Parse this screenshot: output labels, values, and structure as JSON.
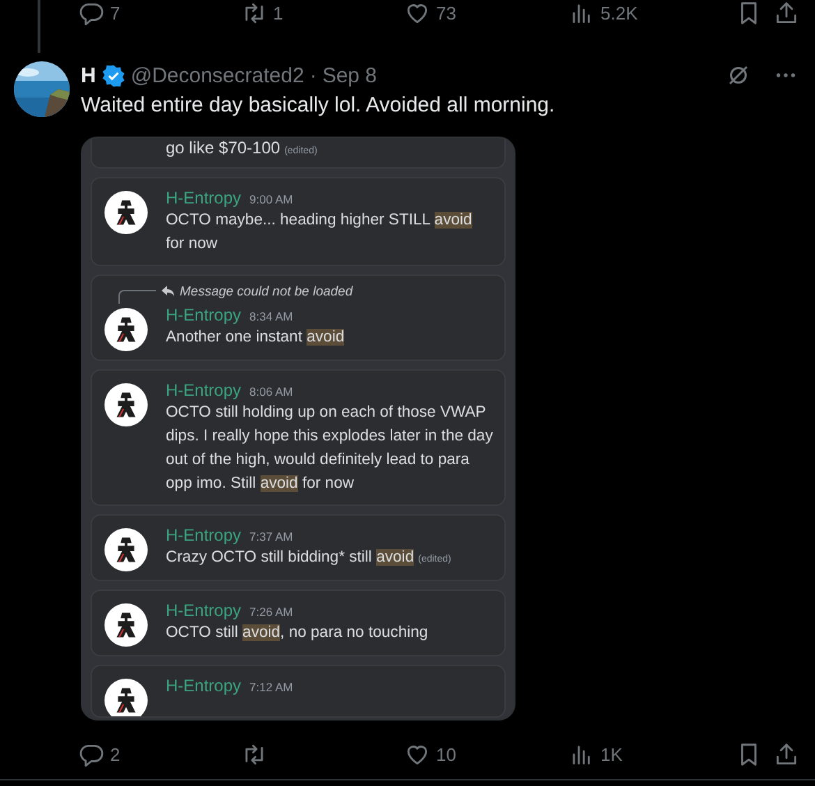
{
  "top_actions": [
    {
      "kind": "reply",
      "count": "7"
    },
    {
      "kind": "repost",
      "count": "1"
    },
    {
      "kind": "like",
      "count": "73"
    },
    {
      "kind": "views",
      "count": "5.2K"
    },
    {
      "kind": "bookmark"
    },
    {
      "kind": "share"
    }
  ],
  "tweet": {
    "name": "H",
    "verified": true,
    "handle": "@Deconsecrated2",
    "separator": "·",
    "date": "Sep 8",
    "text": "Waited entire day basically lol. Avoided all morning."
  },
  "attachment": {
    "messages": [
      {
        "kind": "partial",
        "parts": [
          {
            "text": "go like $70-100",
            "highlight": false
          }
        ],
        "edited": "(edited)"
      },
      {
        "kind": "message",
        "author": "H-Entropy",
        "time": "9:00 AM",
        "parts": [
          {
            "text": "OCTO maybe... heading higher STILL ",
            "highlight": false
          },
          {
            "text": "avoid",
            "highlight": true
          },
          {
            "text": " for now",
            "highlight": false
          }
        ]
      },
      {
        "kind": "message",
        "reply": "Message could not be loaded",
        "author": "H-Entropy",
        "time": "8:34 AM",
        "parts": [
          {
            "text": "Another one instant ",
            "highlight": false
          },
          {
            "text": "avoid",
            "highlight": true
          }
        ]
      },
      {
        "kind": "message",
        "author": "H-Entropy",
        "time": "8:06 AM",
        "parts": [
          {
            "text": "OCTO still holding up on each of those VWAP dips. I really hope this explodes later in the day out of the high, would definitely lead to para opp imo. Still ",
            "highlight": false
          },
          {
            "text": "avoid",
            "highlight": true
          },
          {
            "text": " for now",
            "highlight": false
          }
        ]
      },
      {
        "kind": "message",
        "author": "H-Entropy",
        "time": "7:37 AM",
        "parts": [
          {
            "text": "Crazy OCTO still bidding* still ",
            "highlight": false
          },
          {
            "text": "avoid",
            "highlight": true
          }
        ],
        "edited": "(edited)"
      },
      {
        "kind": "message",
        "author": "H-Entropy",
        "time": "7:26 AM",
        "parts": [
          {
            "text": "OCTO still ",
            "highlight": false
          },
          {
            "text": "avoid",
            "highlight": true
          },
          {
            "text": ", no para no touching",
            "highlight": false
          }
        ]
      },
      {
        "kind": "header",
        "author": "H-Entropy",
        "time": "7:12 AM"
      }
    ]
  },
  "bottom_actions": [
    {
      "kind": "reply",
      "count": "2"
    },
    {
      "kind": "repost"
    },
    {
      "kind": "like",
      "count": "10"
    },
    {
      "kind": "views",
      "count": "1K"
    },
    {
      "kind": "bookmark"
    },
    {
      "kind": "share"
    }
  ]
}
